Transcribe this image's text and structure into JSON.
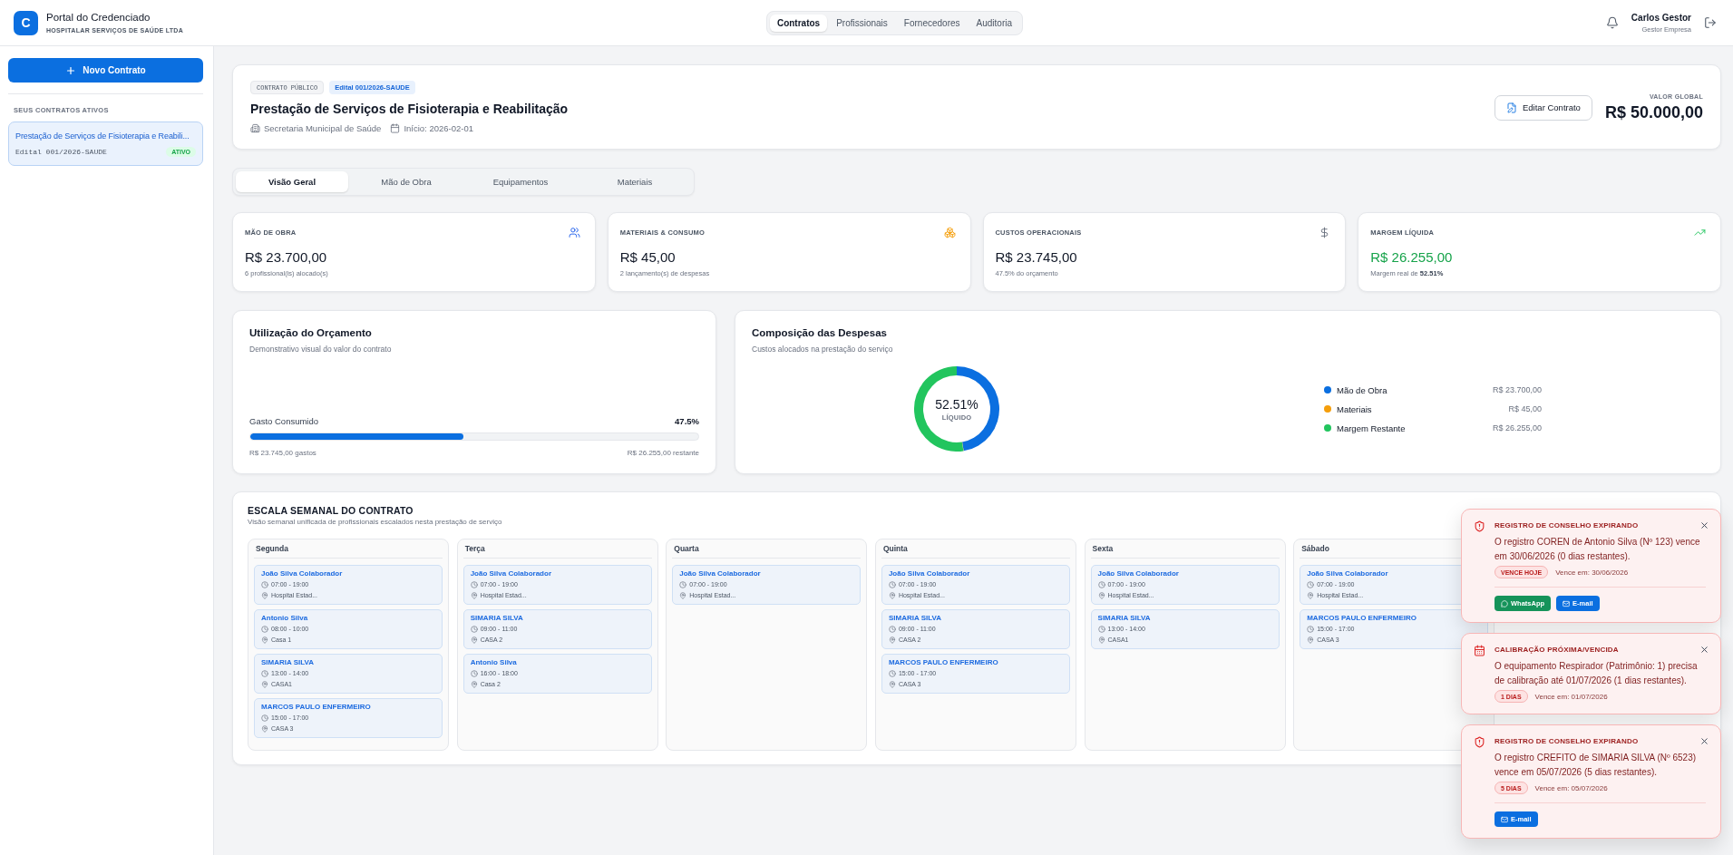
{
  "header": {
    "logo_letter": "C",
    "title": "Portal do Credenciado",
    "subtitle": "HOSPITALAR SERVIÇOS DE SAÚDE LTDA",
    "nav": [
      {
        "label": "Contratos",
        "selected": true
      },
      {
        "label": "Profissionais",
        "selected": false
      },
      {
        "label": "Fornecedores",
        "selected": false
      },
      {
        "label": "Auditoria",
        "selected": false
      }
    ],
    "user": {
      "name": "Carlos Gestor",
      "role": "Gestor Empresa"
    }
  },
  "sidebar": {
    "new_button": "Novo Contrato",
    "section_title": "SEUS CONTRATOS ATIVOS",
    "contracts": [
      {
        "title": "Prestação de Serviços de Fisioterapia e Reabili...",
        "code": "Edital 001/2026-SAUDE",
        "status": "ATIVO",
        "selected": true
      }
    ]
  },
  "contract": {
    "tags": [
      {
        "kind": "type",
        "label": "CONTRATO PÚBLICO"
      },
      {
        "kind": "edital",
        "label": "Edital 001/2026-SAUDE"
      }
    ],
    "title": "Prestação de Serviços de Fisioterapia e Reabilitação",
    "agency": "Secretaria Municipal de Saúde",
    "start": "Início: 2026-02-01",
    "edit_button": "Editar Contrato",
    "value_label": "VALOR GLOBAL",
    "value": "R$ 50.000,00"
  },
  "tabs": [
    {
      "label": "Visão Geral",
      "selected": true
    },
    {
      "label": "Mão de Obra",
      "selected": false
    },
    {
      "label": "Equipamentos",
      "selected": false
    },
    {
      "label": "Materiais",
      "selected": false
    }
  ],
  "stats": [
    {
      "kind": "labor",
      "label": "MÃO DE OBRA",
      "value": "R$ 23.700,00",
      "note": "6 profissional(is) alocado(s)"
    },
    {
      "kind": "materials",
      "label": "MATERIAIS & CONSUMO",
      "value": "R$ 45,00",
      "note": "2 lançamento(s) de despesas"
    },
    {
      "kind": "costs",
      "label": "CUSTOS OPERACIONAIS",
      "value": "R$ 23.745,00",
      "note": "47.5% do orçamento"
    },
    {
      "kind": "margin",
      "label": "MARGEM LÍQUIDA",
      "value": "R$ 26.255,00",
      "note": "Margem real de **52.51%**"
    }
  ],
  "budget": {
    "title": "Utilização do Orçamento",
    "subtitle": "Demonstrativo visual do valor do contrato",
    "bar_label": "Gasto Consumido",
    "percent": "47.5%",
    "level": 0.475,
    "spent": "R$ 23.745,00 gastos",
    "remaining": "R$ 26.255,00 restante"
  },
  "composition": {
    "title": "Composição das Despesas",
    "subtitle": "Custos alocados na prestação do serviço",
    "center_value": "52.51%",
    "center_label": "LÍQUIDO",
    "legend": [
      {
        "label": "Mão de Obra",
        "value": "R$ 23.700,00",
        "color": "#0b6fe0"
      },
      {
        "label": "Materiais",
        "value": "R$ 45,00",
        "color": "#f59e0b"
      },
      {
        "label": "Margem Restante",
        "value": "R$ 26.255,00",
        "color": "#22c55e"
      }
    ],
    "chart_data": {
      "type": "donut",
      "values": [
        47.4,
        0.09,
        52.51
      ]
    }
  },
  "schedule": {
    "title": "ESCALA SEMANAL DO CONTRATO",
    "subtitle": "Visão semanal unificada de profissionais escalados nesta prestação de serviço",
    "days": [
      {
        "label": "Segunda",
        "entries": [
          {
            "name": "João Silva Colaborador",
            "time": "07:00 - 19:00",
            "location": "Hospital Estad..."
          },
          {
            "name": "Antonio Silva",
            "time": "08:00 - 10:00",
            "location": "Casa 1"
          },
          {
            "name": "SIMARIA SILVA",
            "time": "13:00 - 14:00",
            "location": "CASA1"
          },
          {
            "name": "MARCOS PAULO ENFERMEIRO",
            "time": "15:00 - 17:00",
            "location": "CASA 3"
          }
        ]
      },
      {
        "label": "Terça",
        "entries": [
          {
            "name": "João Silva Colaborador",
            "time": "07:00 - 19:00",
            "location": "Hospital Estad..."
          },
          {
            "name": "SIMARIA SILVA",
            "time": "09:00 - 11:00",
            "location": "CASA 2"
          },
          {
            "name": "Antonio Silva",
            "time": "16:00 - 18:00",
            "location": "Casa 2"
          }
        ]
      },
      {
        "label": "Quarta",
        "entries": [
          {
            "name": "João Silva Colaborador",
            "time": "07:00 - 19:00",
            "location": "Hospital Estad..."
          }
        ]
      },
      {
        "label": "Quinta",
        "entries": [
          {
            "name": "João Silva Colaborador",
            "time": "07:00 - 19:00",
            "location": "Hospital Estad..."
          },
          {
            "name": "SIMARIA SILVA",
            "time": "09:00 - 11:00",
            "location": "CASA 2"
          },
          {
            "name": "MARCOS PAULO ENFERMEIRO",
            "time": "15:00 - 17:00",
            "location": "CASA 3"
          }
        ]
      },
      {
        "label": "Sexta",
        "entries": [
          {
            "name": "João Silva Colaborador",
            "time": "07:00 - 19:00",
            "location": "Hospital Estad..."
          },
          {
            "name": "SIMARIA SILVA",
            "time": "13:00 - 14:00",
            "location": "CASA1"
          }
        ]
      },
      {
        "label": "Sábado",
        "entries": [
          {
            "name": "João Silva Colaborador",
            "time": "07:00 - 19:00",
            "location": "Hospital Estad..."
          },
          {
            "name": "MARCOS PAULO ENFERMEIRO",
            "time": "15:00 - 17:00",
            "location": "CASA 3"
          }
        ]
      }
    ]
  },
  "alerts": [
    {
      "kind": "registro",
      "title": "REGISTRO DE CONSELHO EXPIRANDO",
      "message": "O registro COREN de Antonio Silva (Nº 123) vence em 30/06/2026 (0 dias restantes).",
      "badge": "VENCE HOJE",
      "due": "Vence em: 30/06/2026",
      "actions": [
        {
          "kind": "whatsapp",
          "label": "WhatsApp"
        },
        {
          "kind": "email",
          "label": "E-mail"
        }
      ]
    },
    {
      "kind": "calibracao",
      "title": "CALIBRAÇÃO PRÓXIMA/VENCIDA",
      "message": "O equipamento Respirador (Patrimônio: 1) precisa de calibração até 01/07/2026 (1 dias restantes).",
      "badge": "1 DIAS",
      "due": "Vence em: 01/07/2026"
    },
    {
      "kind": "registro",
      "title": "REGISTRO DE CONSELHO EXPIRANDO",
      "message": "O registro CREFITO de SIMARIA SILVA (Nº 6523) vence em 05/07/2026 (5 dias restantes).",
      "badge": "5 DIAS",
      "due": "Vence em: 05/07/2026",
      "actions": [
        {
          "kind": "email",
          "label": "E-mail"
        }
      ]
    }
  ]
}
